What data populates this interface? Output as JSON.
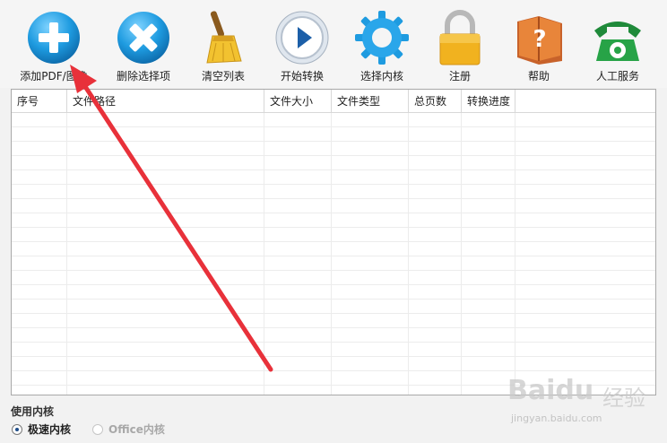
{
  "toolbar": {
    "items": [
      {
        "label": "添加PDF/图像",
        "icon": "add-circle-icon"
      },
      {
        "label": "删除选择项",
        "icon": "delete-circle-icon"
      },
      {
        "label": "清空列表",
        "icon": "broom-icon"
      },
      {
        "label": "开始转换",
        "icon": "play-icon"
      },
      {
        "label": "选择内核",
        "icon": "gear-icon"
      },
      {
        "label": "注册",
        "icon": "lock-icon"
      },
      {
        "label": "帮助",
        "icon": "help-book-icon"
      },
      {
        "label": "人工服务",
        "icon": "telephone-icon"
      }
    ]
  },
  "table": {
    "columns": [
      "序号",
      "文件路径",
      "文件大小",
      "文件类型",
      "总页数",
      "转换进度"
    ],
    "rows": []
  },
  "kernel": {
    "title": "使用内核",
    "options": [
      {
        "label": "极速内核",
        "selected": true,
        "enabled": true
      },
      {
        "label": "Office内核",
        "selected": false,
        "enabled": false
      }
    ]
  },
  "watermark": {
    "brand": "Baidu",
    "suffix": "经验",
    "url": "jingyan.baidu.com"
  },
  "colors": {
    "accent_blue": "#1e90d8",
    "annotation_arrow": "#e8313a"
  }
}
